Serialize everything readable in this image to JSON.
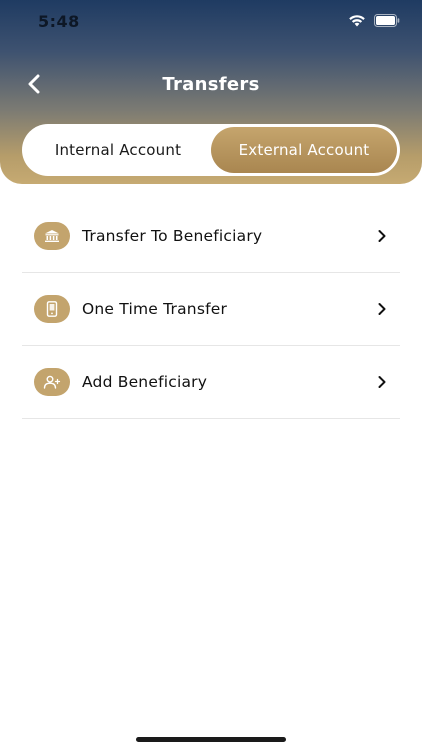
{
  "status_bar": {
    "time": "5:48"
  },
  "header": {
    "title": "Transfers"
  },
  "tabs": [
    {
      "label": "Internal Account",
      "active": false
    },
    {
      "label": "External Account",
      "active": true
    }
  ],
  "menu": {
    "items": [
      {
        "label": "Transfer To Beneficiary",
        "icon": "bank-icon"
      },
      {
        "label": "One Time Transfer",
        "icon": "phone-icon"
      },
      {
        "label": "Add Beneficiary",
        "icon": "add-user-icon"
      }
    ]
  },
  "colors": {
    "accent_gold": "#c3a46d",
    "header_top": "#1f3b62",
    "header_bottom": "#c6aa72"
  }
}
